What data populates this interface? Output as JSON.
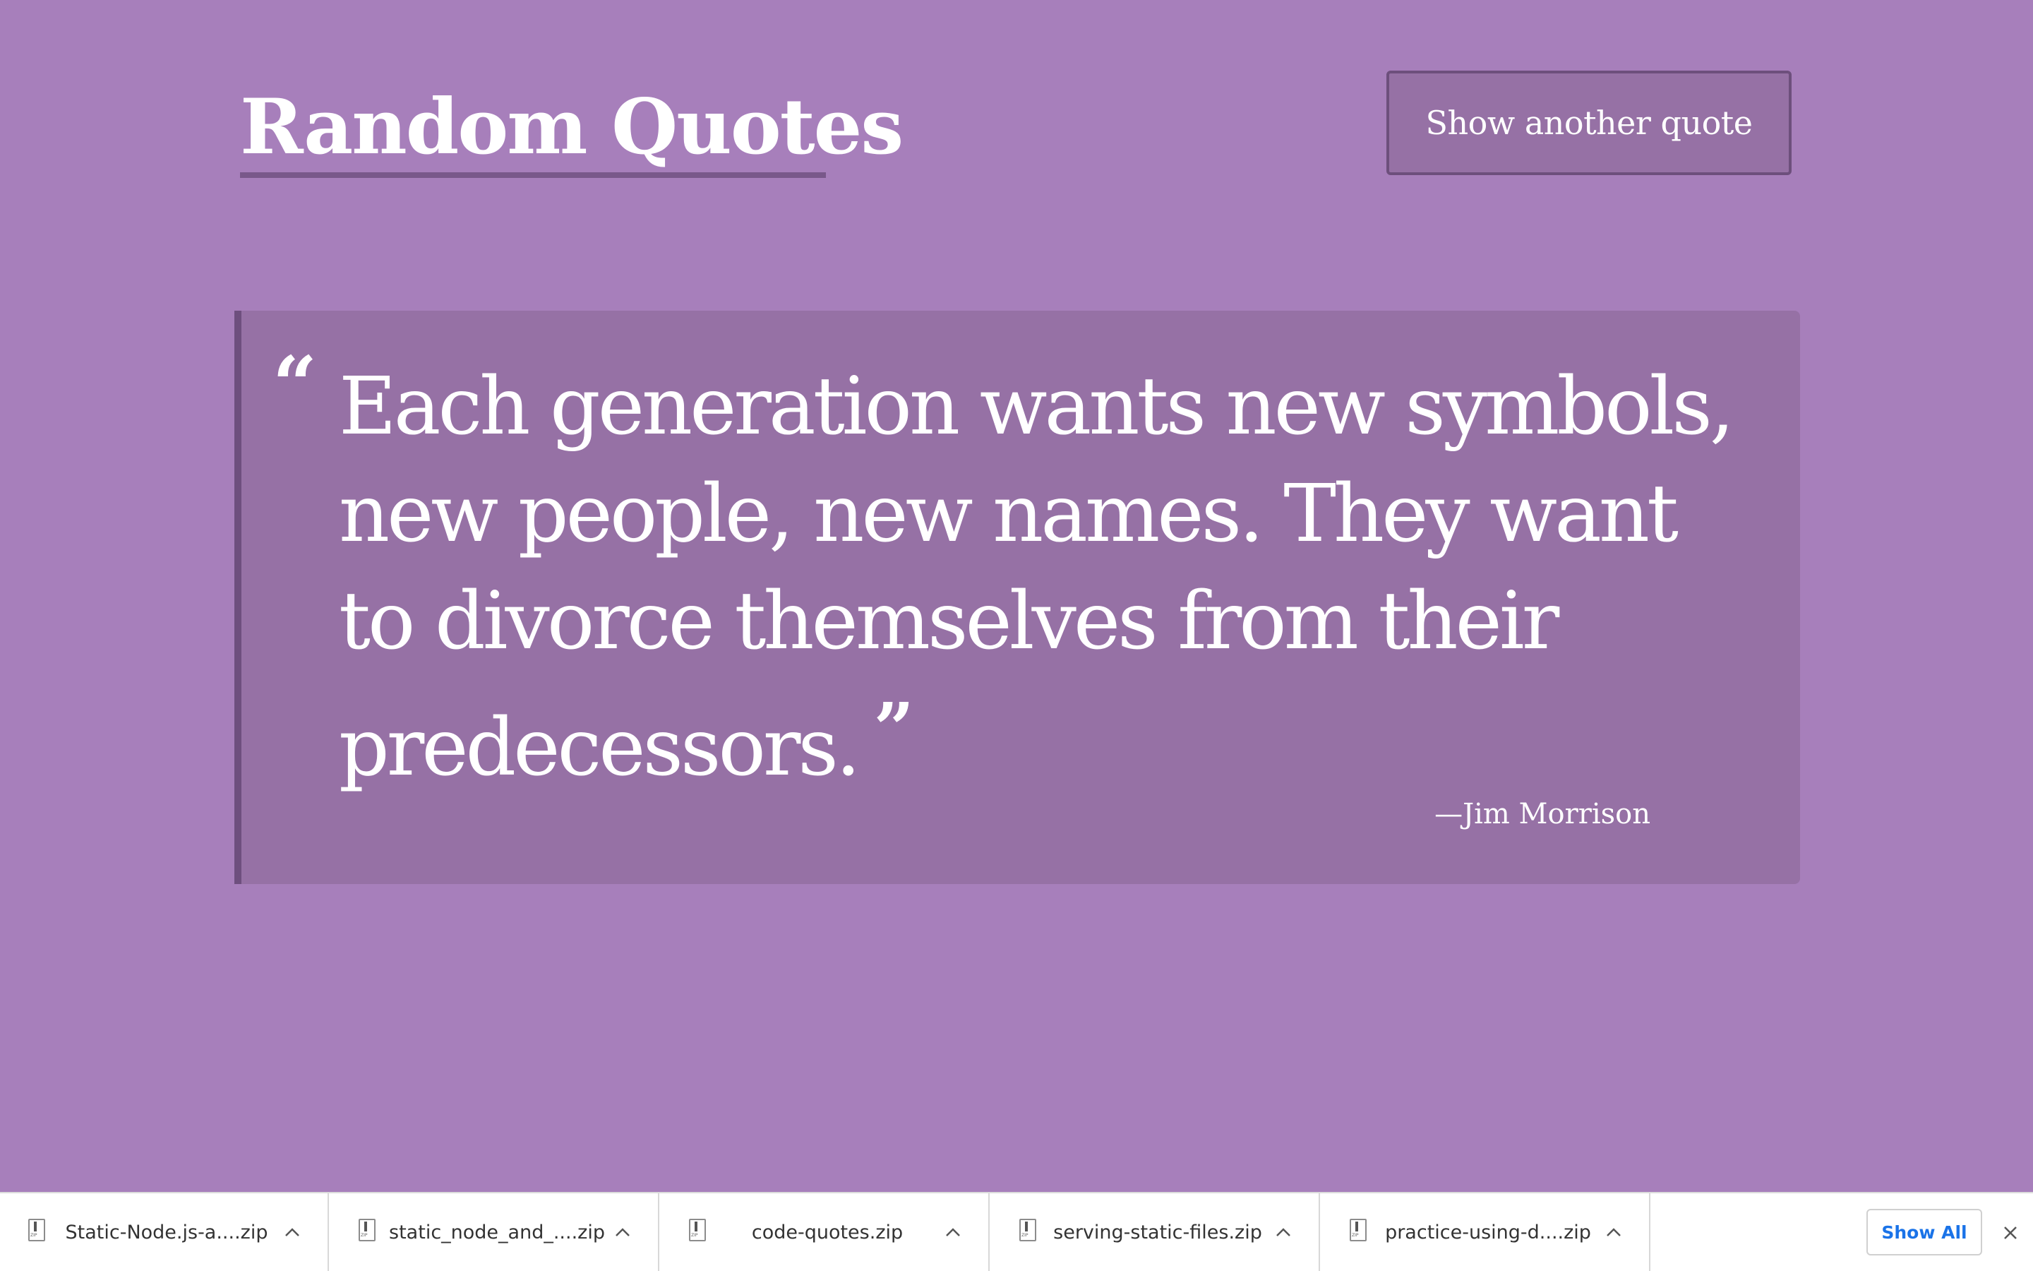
{
  "header": {
    "title": "Random Quotes",
    "button_label": "Show another quote"
  },
  "quote": {
    "open_mark": "“",
    "text": "Each generation wants new symbols, new people, new names. They want to divorce themselves from their predecessors.",
    "close_mark": "”",
    "author": "—Jim Morrison"
  },
  "downloads": {
    "items": [
      {
        "name": "Static-Node.js-a....zip",
        "icon": "zip-file-icon"
      },
      {
        "name": "static_node_and_....zip",
        "icon": "zip-file-icon"
      },
      {
        "name": "code-quotes.zip",
        "icon": "zip-file-icon"
      },
      {
        "name": "serving-static-files.zip",
        "icon": "zip-file-icon"
      },
      {
        "name": "practice-using-d....zip",
        "icon": "zip-file-icon"
      }
    ],
    "show_all_label": "Show All"
  },
  "colors": {
    "background": "#a77fbb",
    "quote_box": "#9671a5",
    "accent_border": "#6e4f7e",
    "link_blue": "#1a73e8"
  }
}
